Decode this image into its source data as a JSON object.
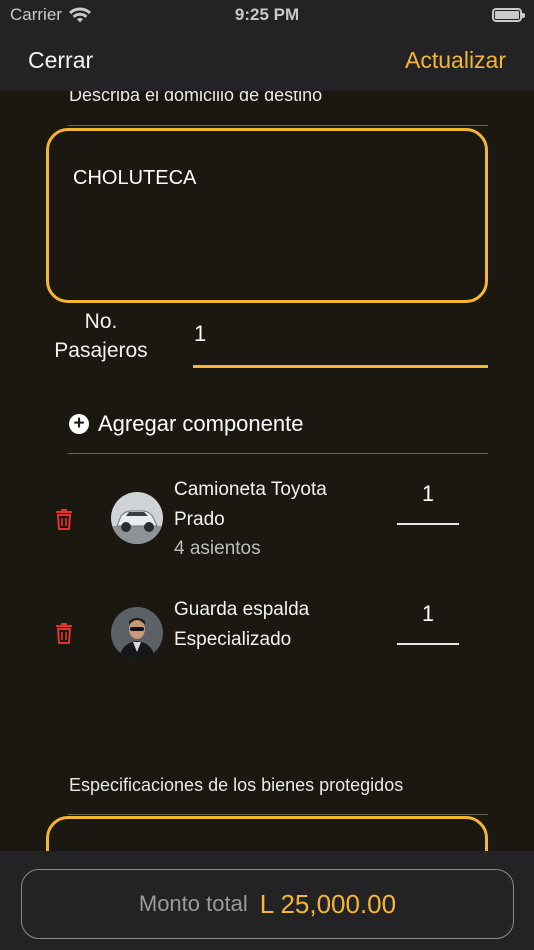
{
  "status_bar": {
    "carrier": "Carrier",
    "time": "9:25 PM"
  },
  "nav": {
    "close_label": "Cerrar",
    "update_label": "Actualizar"
  },
  "destination": {
    "label": "Describa el domicilio de destino",
    "value": "CHOLUTECA"
  },
  "passengers": {
    "label_line1": "No.",
    "label_line2": "Pasajeros",
    "value": "1"
  },
  "add_component_label": "Agregar componente",
  "components": [
    {
      "title_line1": "Camioneta Toyota",
      "title_line2": "Prado",
      "subtitle": "4 asientos",
      "quantity": "1",
      "thumbnail": "suv-vehicle-photo"
    },
    {
      "title_line1": "Guarda espalda",
      "title_line2": "Especializado",
      "subtitle": "",
      "quantity": "1",
      "thumbnail": "bodyguard-photo"
    }
  ],
  "goods_spec_label": "Especificaciones de los bienes protegidos",
  "total": {
    "label": "Monto total",
    "value": "L 25,000.00"
  },
  "colors": {
    "accent": "#f5b731",
    "background": "#1b1711",
    "bar": "#232326",
    "delete": "#e0332d"
  },
  "icons": [
    "wifi-icon",
    "battery-icon",
    "plus-circle-icon",
    "trash-icon"
  ]
}
